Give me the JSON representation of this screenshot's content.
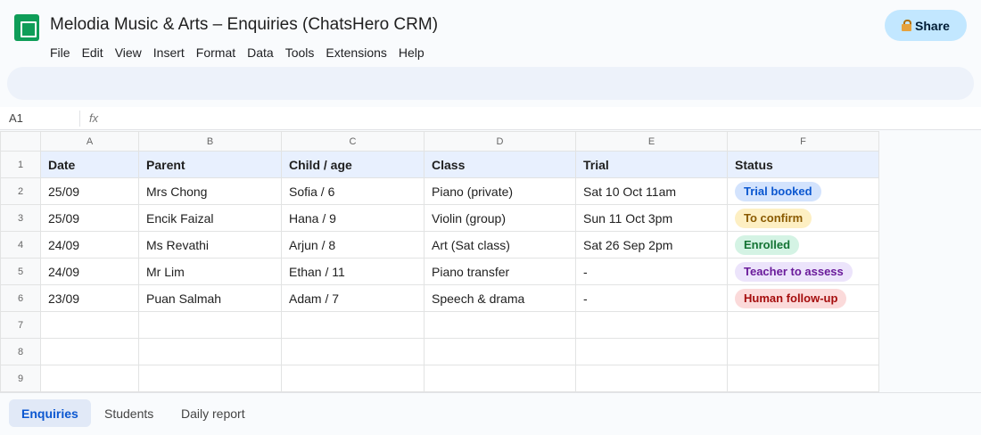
{
  "document": {
    "title": "Melodia Music & Arts – Enquiries (ChatsHero CRM)"
  },
  "menu": [
    "File",
    "Edit",
    "View",
    "Insert",
    "Format",
    "Data",
    "Tools",
    "Extensions",
    "Help"
  ],
  "share": {
    "label": "Share",
    "icon": "lock-icon"
  },
  "formula_bar": {
    "cell_ref": "A1",
    "fx_label": "fx"
  },
  "columns": [
    "A",
    "B",
    "C",
    "D",
    "E",
    "F"
  ],
  "row_numbers": [
    "1",
    "2",
    "3",
    "4",
    "5",
    "6",
    "7",
    "8",
    "9"
  ],
  "table": {
    "headers": [
      "Date",
      "Parent",
      "Child / age",
      "Class",
      "Trial",
      "Status"
    ],
    "rows": [
      {
        "date": "25/09",
        "parent": "Mrs Chong",
        "child": "Sofia / 6",
        "class": "Piano (private)",
        "trial": "Sat 10 Oct 11am",
        "status": "Trial booked",
        "status_bg": "#d3e3fd",
        "status_fg": "#0b57d0"
      },
      {
        "date": "25/09",
        "parent": "Encik Faizal",
        "child": "Hana / 9",
        "class": "Violin (group)",
        "trial": "Sun 11 Oct 3pm",
        "status": "To confirm",
        "status_bg": "#fdefc3",
        "status_fg": "#8a5a00"
      },
      {
        "date": "24/09",
        "parent": "Ms Revathi",
        "child": "Arjun / 8",
        "class": "Art (Sat class)",
        "trial": "Sat 26 Sep 2pm",
        "status": "Enrolled",
        "status_bg": "#d4f3e4",
        "status_fg": "#137333"
      },
      {
        "date": "24/09",
        "parent": "Mr Lim",
        "child": "Ethan / 11",
        "class": "Piano transfer",
        "trial": "-",
        "status": "Teacher to assess",
        "status_bg": "#ece4fb",
        "status_fg": "#6a1b9a"
      },
      {
        "date": "23/09",
        "parent": "Puan Salmah",
        "child": "Adam / 7",
        "class": "Speech & drama",
        "trial": "-",
        "status": "Human follow-up",
        "status_bg": "#fbdada",
        "status_fg": "#a50e0e"
      }
    ]
  },
  "sheet_tabs": [
    {
      "label": "Enquiries",
      "active": true
    },
    {
      "label": "Students",
      "active": false
    },
    {
      "label": "Daily report",
      "active": false
    }
  ]
}
